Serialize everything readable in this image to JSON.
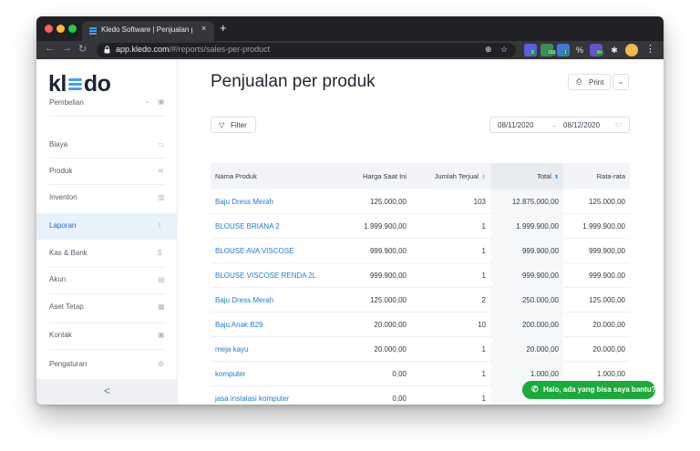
{
  "browser": {
    "tab_title": "Kledo Software | Penjualan per",
    "close_glyph": "×",
    "new_tab_glyph": "+",
    "url_host": "app.kledo.com",
    "url_path": "/#/reports/sales-per-product",
    "ext_badges": [
      "8",
      "160",
      "1",
      "9+"
    ]
  },
  "sidebar": {
    "logo_left": "kl",
    "logo_right": "do",
    "items": [
      {
        "label": "Pembelian",
        "icon": "▣"
      },
      {
        "label": "Biaya",
        "icon": "▭"
      },
      {
        "label": "Produk",
        "icon": "≋"
      },
      {
        "label": "Inventori",
        "icon": "▥"
      },
      {
        "label": "Laporan",
        "icon": "⌇"
      },
      {
        "label": "Kas & Bank",
        "icon": "$"
      },
      {
        "label": "Akun",
        "icon": "▤"
      },
      {
        "label": "Aset Tetap",
        "icon": "▦"
      },
      {
        "label": "Kontak",
        "icon": "▣"
      },
      {
        "label": "Pengaturan",
        "icon": "⚙"
      }
    ],
    "pembelian_chevron": "⌄",
    "collapse_glyph": "<",
    "active_index": 4
  },
  "main": {
    "title": "Penjualan per produk",
    "print_label": "Print",
    "print_icon": "⎙",
    "dropdown_glyph": "⌄",
    "filter_label": "Filter",
    "filter_icon": "▽",
    "date_start": "08/11/2020",
    "date_arrow": "→",
    "date_end": "08/12/2020",
    "calendar_icon": "▭"
  },
  "table": {
    "columns": [
      "Nama Produk",
      "Harga Saat Ini",
      "Jumlah Terjual",
      "Total",
      "Rata-rata"
    ],
    "sort_glyph": "⬍",
    "rows": [
      [
        "Baju Dress Merah",
        "125.000,00",
        "103",
        "12.875.000,00",
        "125.000,00"
      ],
      [
        "BLOUSE BRIANA 2",
        "1.999.900,00",
        "1",
        "1.999.900,00",
        "1.999.900,00"
      ],
      [
        "BLOUSE AVA VISCOSE",
        "999.900,00",
        "1",
        "999.900,00",
        "999.900,00"
      ],
      [
        "BLOUSE VISCOSE RENDA 2L",
        "999.900,00",
        "1",
        "999.900,00",
        "999.900,00"
      ],
      [
        "Baju Dress Merah",
        "125.000,00",
        "2",
        "250.000,00",
        "125.000,00"
      ],
      [
        "Baju Anak B29",
        "20.000,00",
        "10",
        "200.000,00",
        "20.000,00"
      ],
      [
        "meja kayu",
        "20.000,00",
        "1",
        "20.000,00",
        "20.000,00"
      ],
      [
        "komputer",
        "0,00",
        "1",
        "1.000,00",
        "1.000,00"
      ],
      [
        "jasa instalasi komputer",
        "0,00",
        "1",
        "",
        ""
      ]
    ]
  },
  "chat": {
    "label": "Halo, ada yang bisa saya bantu?",
    "icon": "✆"
  }
}
